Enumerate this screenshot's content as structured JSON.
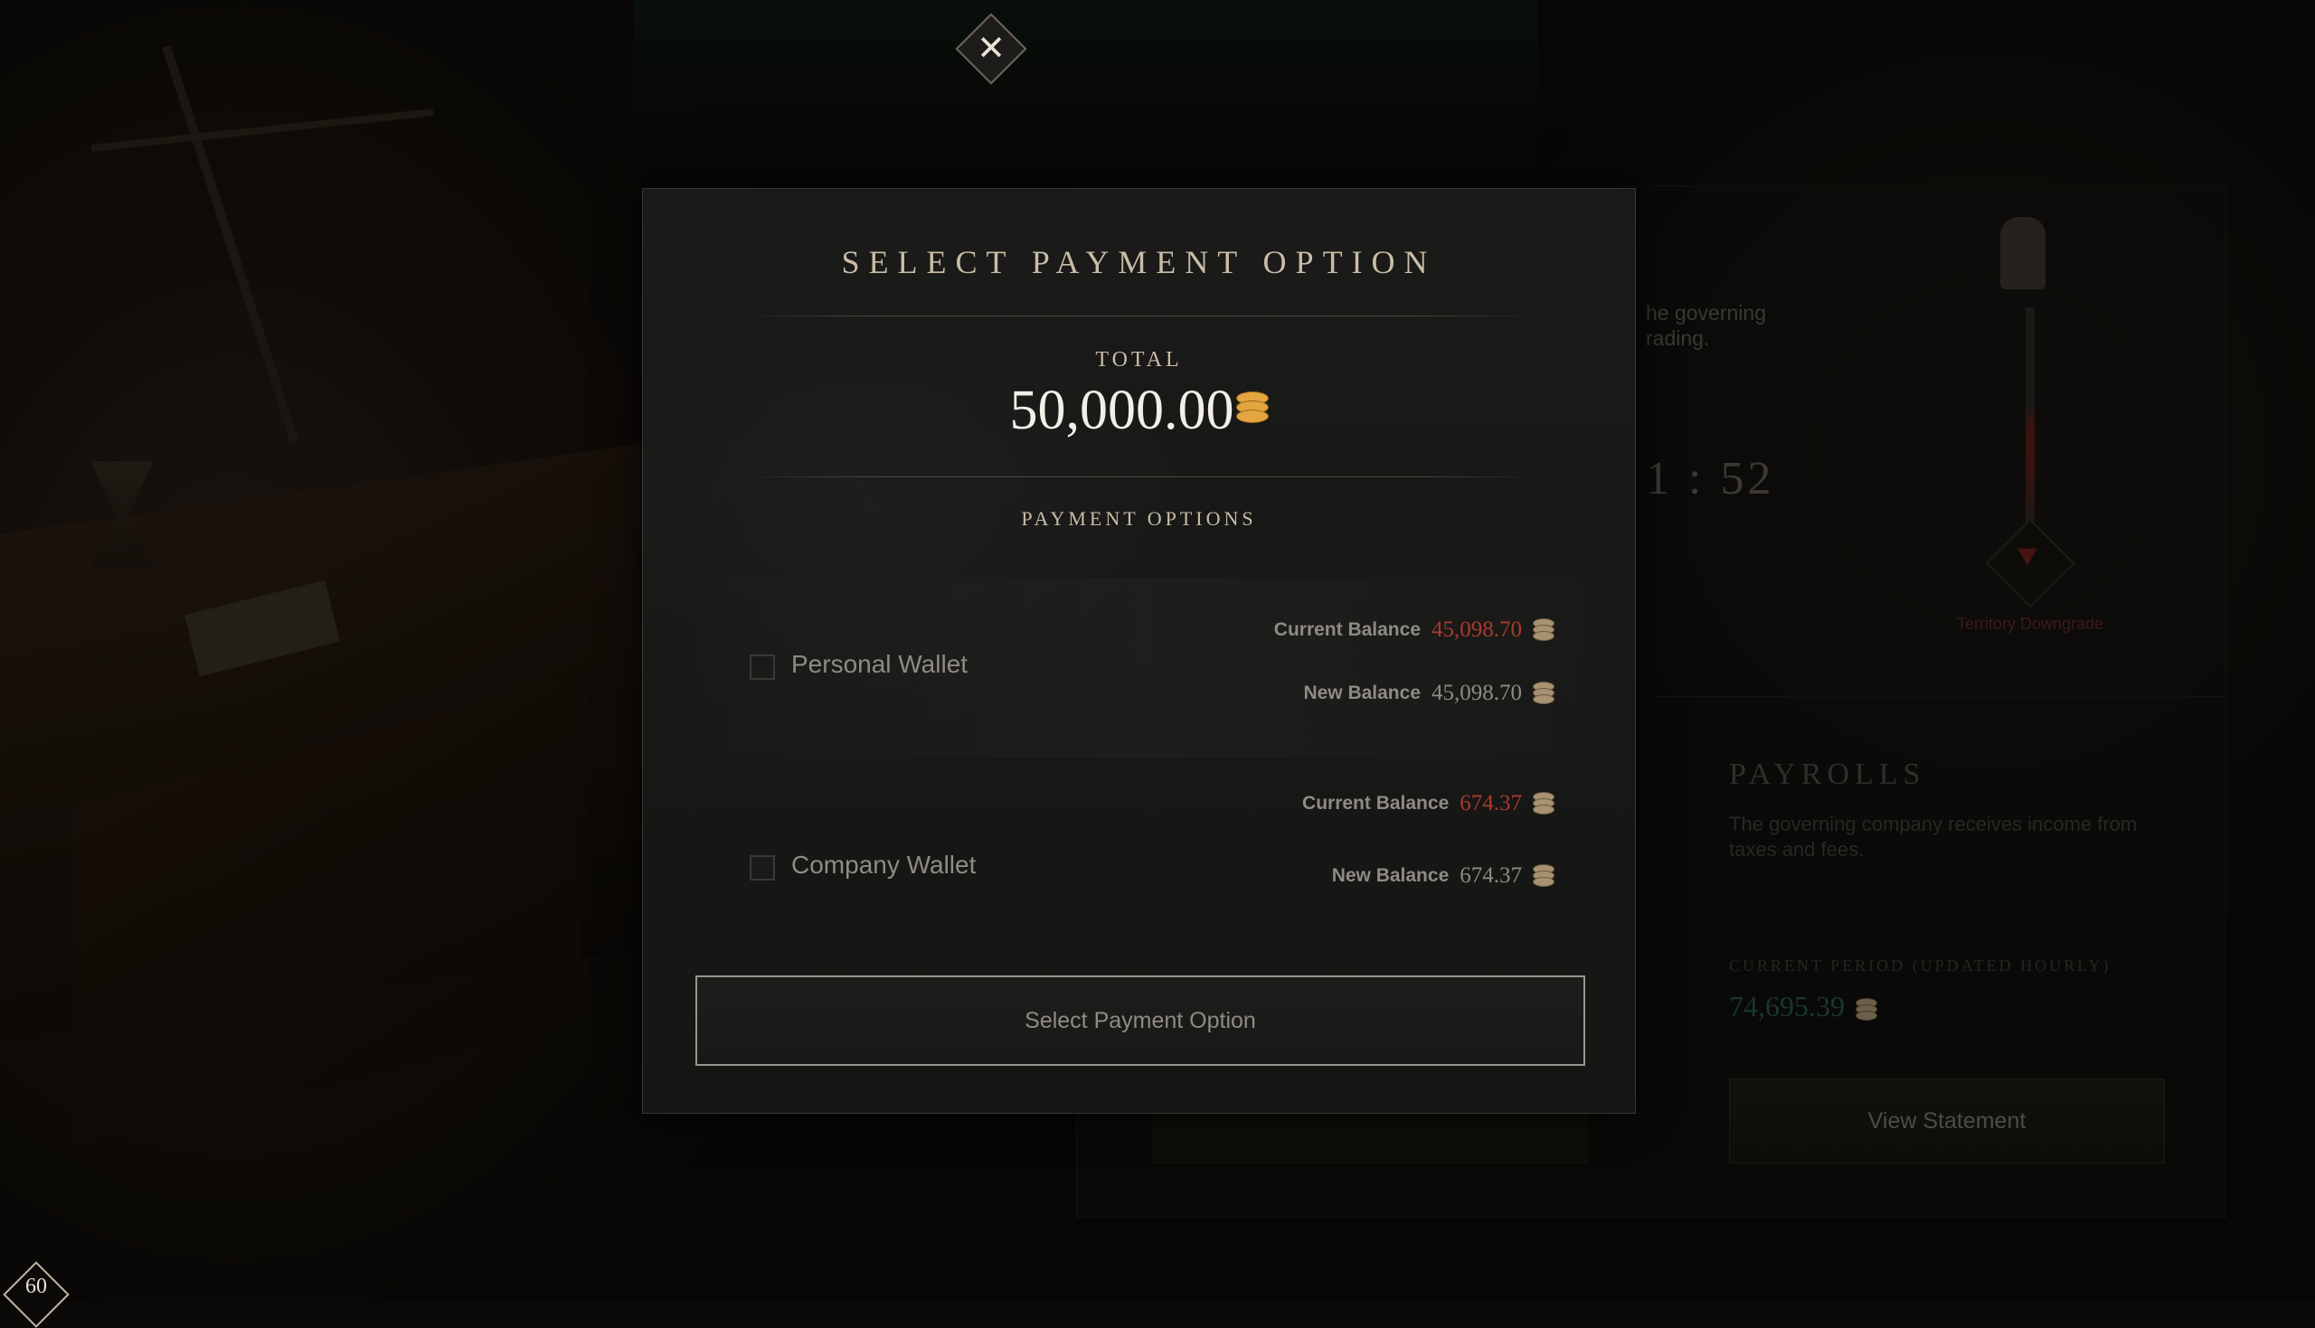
{
  "modal": {
    "title": "SELECT PAYMENT OPTION",
    "total_label": "TOTAL",
    "total_value": "50,000.00",
    "payment_options_label": "PAYMENT OPTIONS",
    "options": [
      {
        "name": "Personal Wallet",
        "current_balance_label": "Current Balance",
        "current_balance": "45,098.70",
        "new_balance_label": "New Balance",
        "new_balance": "45,098.70"
      },
      {
        "name": "Company Wallet",
        "current_balance_label": "Current Balance",
        "current_balance": "674.37",
        "new_balance_label": "New Balance",
        "new_balance": "674.37"
      }
    ],
    "select_button": "Select Payment Option",
    "close_icon": "close-x-icon"
  },
  "background": {
    "description_fragment": "he governing\nrading.",
    "timer_fragment": "1 : 52",
    "territory_label": "Territory Downgrade",
    "payrolls_title": "PAYROLLS",
    "payrolls_desc": "The governing company receives income from taxes and fees.",
    "period_label": "CURRENT PERIOD (UPDATED HOURLY)",
    "period_value": "74,695.39",
    "view_statement": "View Statement"
  },
  "fps": "60",
  "colors": {
    "negative_balance": "#a83a2c",
    "gold_coin": "#e3a540",
    "period_value": "#27524a"
  }
}
